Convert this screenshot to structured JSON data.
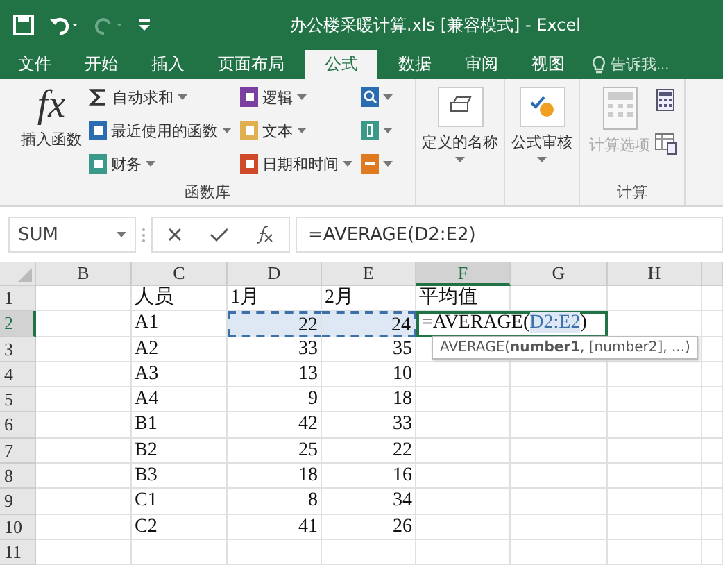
{
  "window": {
    "title": "办公楼采暖计算.xls  [兼容模式] - Excel"
  },
  "tabs": [
    {
      "label": "文件",
      "selected": false
    },
    {
      "label": "开始",
      "selected": false
    },
    {
      "label": "插入",
      "selected": false
    },
    {
      "label": "页面布局",
      "selected": false
    },
    {
      "label": "公式",
      "selected": true
    },
    {
      "label": "数据",
      "selected": false
    },
    {
      "label": "审阅",
      "selected": false
    },
    {
      "label": "视图",
      "selected": false
    }
  ],
  "tell_me": {
    "placeholder": "告诉我..."
  },
  "ribbon": {
    "function_library": {
      "label": "函数库",
      "insert_function": "插入函数",
      "insert_function_icon": "fx",
      "buttons": [
        {
          "label": "自动求和"
        },
        {
          "label": "最近使用的函数"
        },
        {
          "label": "财务"
        },
        {
          "label": "逻辑"
        },
        {
          "label": "文本"
        },
        {
          "label": "日期和时间"
        }
      ]
    },
    "defined_names": {
      "label": "定义的名称"
    },
    "formula_auditing": {
      "label": "公式审核"
    },
    "calculation": {
      "label": "计算",
      "options": "计算选项",
      "options_disabled": true
    }
  },
  "name_box": "SUM",
  "formula_bar": {
    "value": "=AVERAGE(D2:E2)"
  },
  "columns": [
    {
      "label": "B",
      "selected": false
    },
    {
      "label": "C",
      "selected": false
    },
    {
      "label": "D",
      "selected": false
    },
    {
      "label": "E",
      "selected": false
    },
    {
      "label": "F",
      "selected": true
    },
    {
      "label": "G",
      "selected": false
    },
    {
      "label": "H",
      "selected": false
    }
  ],
  "rows": [
    {
      "number": "1",
      "editing": false,
      "referenced": false,
      "c": "人员",
      "d": "1月",
      "e": "2月",
      "f": "平均值"
    },
    {
      "number": "2",
      "editing": true,
      "referenced": true,
      "c": "A1",
      "d": "22",
      "e": "24",
      "formula": [
        "=AVERAGE(",
        "D2:E2",
        ")"
      ]
    },
    {
      "number": "3",
      "editing": false,
      "referenced": false,
      "c": "A2",
      "d": "33",
      "e": "35"
    },
    {
      "number": "4",
      "editing": false,
      "referenced": false,
      "c": "A3",
      "d": "13",
      "e": "10"
    },
    {
      "number": "5",
      "editing": false,
      "referenced": false,
      "c": "A4",
      "d": "9",
      "e": "18"
    },
    {
      "number": "6",
      "editing": false,
      "referenced": false,
      "c": "B1",
      "d": "42",
      "e": "33"
    },
    {
      "number": "7",
      "editing": false,
      "referenced": false,
      "c": "B2",
      "d": "25",
      "e": "22"
    },
    {
      "number": "8",
      "editing": false,
      "referenced": false,
      "c": "B3",
      "d": "18",
      "e": "16"
    },
    {
      "number": "9",
      "editing": false,
      "referenced": false,
      "c": "C1",
      "d": "8",
      "e": "34"
    },
    {
      "number": "10",
      "editing": false,
      "referenced": false,
      "c": "C2",
      "d": "41",
      "e": "26"
    },
    {
      "number": "11",
      "editing": false,
      "referenced": false
    }
  ],
  "tooltip": "AVERAGE(**number1**, [number2], ...)"
}
